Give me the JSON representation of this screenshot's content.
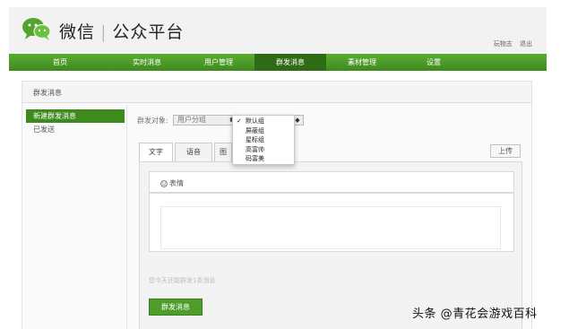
{
  "header": {
    "brand_left": "微信",
    "brand_right": "公众平台",
    "user_name": "玩物志",
    "logout": "退出"
  },
  "nav": [
    {
      "label": "首页",
      "width": 114
    },
    {
      "label": "实时消息",
      "width": 80
    },
    {
      "label": "用户管理",
      "width": 80
    },
    {
      "label": "群发消息",
      "width": 80,
      "active": true
    },
    {
      "label": "素材管理",
      "width": 80
    },
    {
      "label": "设置",
      "width": 80
    }
  ],
  "breadcrumb": "群发消息",
  "sidebar": {
    "items": [
      {
        "label": "新建群发消息",
        "active": true
      },
      {
        "label": "已发送"
      }
    ]
  },
  "form": {
    "target_label": "群发对象:",
    "group_select": "用户分组",
    "second_select": "◆"
  },
  "dropdown": {
    "options": [
      "默认组",
      "屏蔽组",
      "星标组",
      "高富帅",
      "码富美"
    ],
    "checked": "默认组"
  },
  "tabs": [
    {
      "label": "文字",
      "active": true
    },
    {
      "label": "语音"
    },
    {
      "label": "图"
    }
  ],
  "upload_label": "上传",
  "editor": {
    "emoji_label": "表情",
    "hint": "您今天还能群发1条消息"
  },
  "send_label": "群发消息",
  "watermark": "头条 @青花会游戏百科",
  "colors": {
    "accent": "#4a9b26",
    "nav_active": "#2e6b14"
  }
}
